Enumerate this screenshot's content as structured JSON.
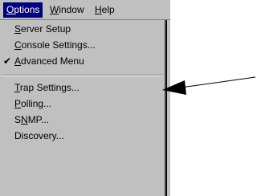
{
  "menubar": {
    "items": [
      {
        "mnemonic": "O",
        "rest": "ptions"
      },
      {
        "mnemonic": "W",
        "rest": "indow"
      },
      {
        "mnemonic": "H",
        "rest": "elp"
      }
    ]
  },
  "menu": {
    "items": [
      {
        "pre": "",
        "mnemonic": "S",
        "rest": "erver Setup",
        "checked": false
      },
      {
        "pre": "",
        "mnemonic": "C",
        "rest": "onsole Settings...",
        "checked": false
      },
      {
        "pre": "",
        "mnemonic": "A",
        "rest": "dvanced Menu",
        "checked": true
      },
      {
        "pre": "",
        "mnemonic": "T",
        "rest": "rap Settings...",
        "checked": false
      },
      {
        "pre": "",
        "mnemonic": "P",
        "rest": "olling...",
        "checked": false
      },
      {
        "pre": "S",
        "mnemonic": "N",
        "rest": "MP...",
        "checked": false
      },
      {
        "pre": "",
        "mnemonic": "",
        "rest": "Discovery...",
        "checked": false
      }
    ],
    "check_glyph": "✔"
  },
  "colors": {
    "menu_bg": "#c0c0c0",
    "highlight": "#000080",
    "highlight_text": "#ffffff"
  }
}
